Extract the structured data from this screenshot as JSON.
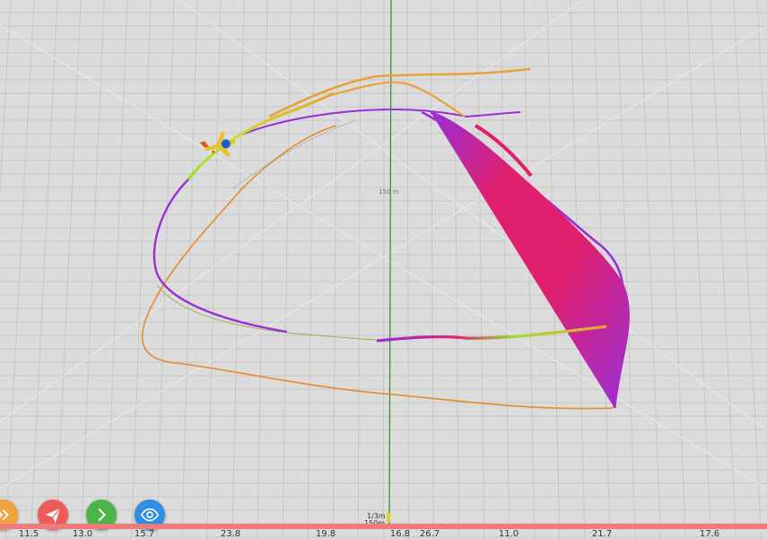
{
  "scene": {
    "center_label": "150 m",
    "bottom_label_1": "1/3m",
    "bottom_label_2": "150m"
  },
  "toolbar": {
    "buttons": [
      {
        "name": "expand-button",
        "icon": "double-chevron-right-icon",
        "color": "#f0a33a"
      },
      {
        "name": "flight-button",
        "icon": "paper-plane-icon",
        "color": "#ef5b5b"
      },
      {
        "name": "next-button",
        "icon": "chevron-right-icon",
        "color": "#4cb54a"
      },
      {
        "name": "view-button",
        "icon": "eye-icon",
        "color": "#2f8ee5"
      }
    ]
  },
  "timeline": {
    "color": "#ef7c7c",
    "ticks": [
      "11.5",
      "13.0",
      "15.7",
      "23.8",
      "19.8",
      "16.8",
      "26.7",
      "11.0",
      "21.7",
      "17.6"
    ]
  },
  "colors": {
    "background": "#dcdcdc",
    "grid": "#c6c6c6",
    "axis": "#2e8b2e",
    "trail_purple": "#9a2fd6",
    "trail_orange": "#e88a2a",
    "trail_magenta": "#e0206e",
    "trail_green": "#9ee02e"
  }
}
